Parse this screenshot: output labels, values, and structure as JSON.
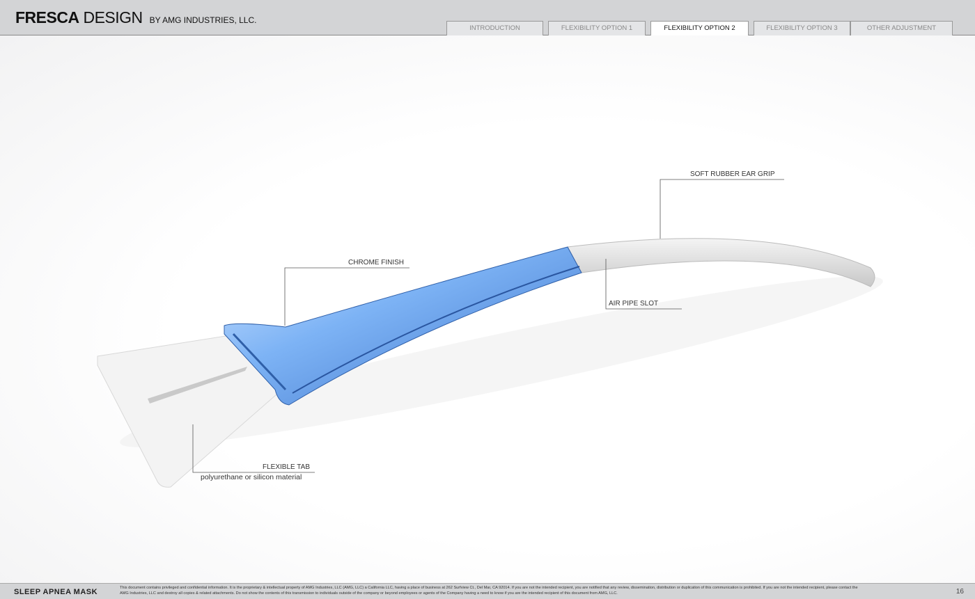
{
  "header": {
    "brand_bold": "FRESCA",
    "brand_light": "DESIGN",
    "brand_sub": "BY AMG INDUSTRIES, LLC."
  },
  "tabs": [
    {
      "label": "INTRODUCTION",
      "active": false
    },
    {
      "label": "FLEXIBILITY OPTION 1",
      "active": false
    },
    {
      "label": "FLEXIBILITY OPTION 2",
      "active": true
    },
    {
      "label": "FLEXIBILITY OPTION 3",
      "active": false
    },
    {
      "label": "OTHER ADJUSTMENT",
      "active": false
    }
  ],
  "callouts": {
    "ear_grip": "SOFT RUBBER EAR GRIP",
    "chrome": "CHROME FINISH",
    "air_pipe": "AIR PIPE SLOT",
    "flex_tab": "FLEXIBLE TAB",
    "flex_tab_sub": "polyurethane or silicon material"
  },
  "colors": {
    "chrome_blue": "#6fa8f0",
    "header_bg": "#d3d4d6"
  },
  "footer": {
    "title": "SLEEP APNEA MASK",
    "note": "This document contains privileged and confidential information. It is the proprietary & intellectual property of AMG Industries, LLC (AMG, LLC) a California LLC, having a place of business at 262 Surfview Ct., Del Mar, CA 92014. If you are not the intended recipient, you are notified that any review, dissemination, distribution or duplication of this communication is prohibited. If you are not the intended recipient, please contact the AMG Industries, LLC and destroy all copies & related attachments. Do not show the contents of this transmission to individuals outside of the company or beyond employees or agents of the Company having a need to know if you are the intended recipient of this document from AMG, LLC.",
    "page": "16"
  }
}
